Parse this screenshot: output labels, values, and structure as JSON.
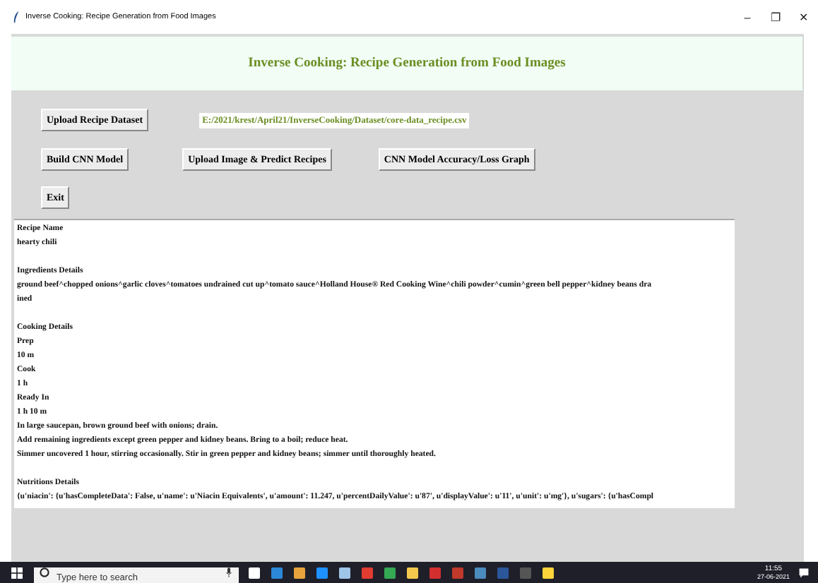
{
  "window": {
    "title": "Inverse Cooking: Recipe Generation from Food Images",
    "controls": [
      "–",
      "❐",
      "✕"
    ]
  },
  "header": "Inverse Cooking: Recipe Generation from Food Images",
  "buttons_row1": {
    "button": "Upload Recipe Dataset",
    "path": "E:/2021/krest/April21/InverseCooking/Dataset/core-data_recipe.csv"
  },
  "buttons_row2": [
    "Build CNN Model",
    "Upload Image & Predict Recipes",
    "CNN Model Accuracy/Loss Graph"
  ],
  "exit_button": "Exit",
  "output_sections": [
    [
      "Recipe Name",
      "hearty chili"
    ],
    [
      "Ingredients Details",
      "ground beef^chopped onions^garlic cloves^tomatoes undrained cut up^tomato sauce^Holland House® Red Cooking Wine^chili powder^cumin^green bell pepper^kidney beans dra",
      "ined"
    ],
    [
      "Cooking Details",
      "Prep",
      "10 m",
      "Cook",
      "1 h",
      "Ready In",
      "1 h 10 m",
      "In large saucepan, brown ground beef with onions; drain.",
      "Add remaining ingredients except green pepper and kidney beans. Bring to a boil; reduce heat.",
      "Simmer uncovered 1 hour, stirring occasionally. Stir in green pepper and kidney beans; simmer until thoroughly heated."
    ],
    [
      "Nutritions Details",
      "{u'niacin': {u'hasCompleteData': False, u'name': u'Niacin Equivalents', u'amount': 11.247, u'percentDailyValue': u'87', u'displayValue': u'11', u'unit': u'mg'}, u'sugars': {u'hasCompl"
    ]
  ],
  "taskbar": {
    "search_placeholder": "Type here to search",
    "time": "11:55",
    "date": "27-06-2021",
    "apps": [
      {
        "color": "#ffffff"
      },
      {
        "color": "#2b88d8"
      },
      {
        "color": "#e8a33d"
      },
      {
        "color": "#1e90ff"
      },
      {
        "color": "#9fc5e8"
      },
      {
        "color": "#e03c31"
      },
      {
        "color": "#34a853"
      },
      {
        "color": "#f2c94c"
      },
      {
        "color": "#d32f2f"
      },
      {
        "color": "#c0392b"
      },
      {
        "color": "#4b8bbe"
      },
      {
        "color": "#2b579a"
      },
      {
        "color": "#555555"
      },
      {
        "color": "#ffd43b"
      }
    ]
  }
}
